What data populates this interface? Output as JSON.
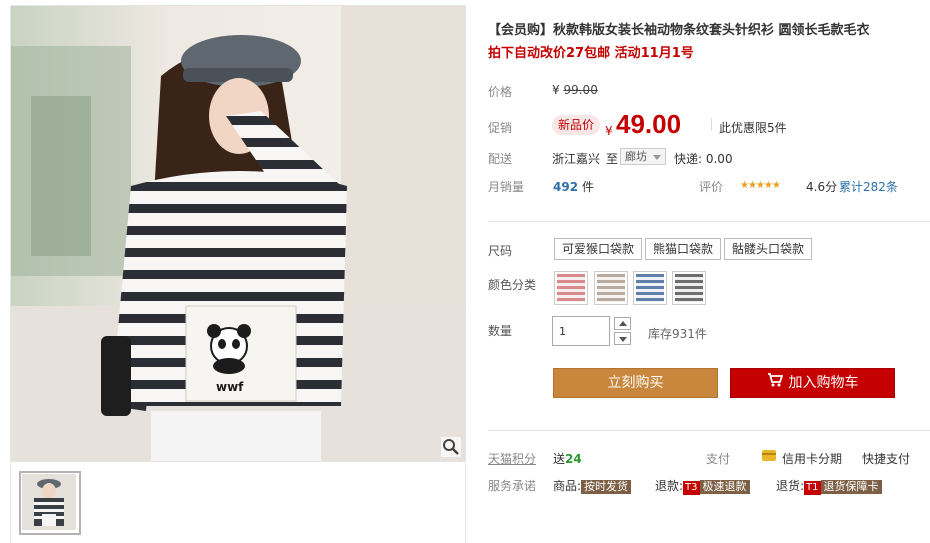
{
  "product": {
    "title": "【会员购】秋款韩版女装长袖动物条纹套头针织衫 圆领长毛款毛衣",
    "promo_line": "拍下自动改价27包邮 活动11月1号"
  },
  "price": {
    "label": "价格",
    "currency": "¥",
    "original": "99.00"
  },
  "promotion": {
    "label": "促销",
    "tag": "新品价",
    "currency": "¥",
    "value": "49.00",
    "limit_note": "此优惠限5件"
  },
  "delivery": {
    "label": "配送",
    "from": "浙江嘉兴",
    "to_word": "至",
    "destination": "廊坊",
    "shipping": "快递: 0.00"
  },
  "sales": {
    "label": "月销量",
    "count": "492",
    "unit": "件",
    "rating_label": "评价",
    "stars": "★★★★★",
    "score": "4.6分",
    "reviews": "累计282条"
  },
  "size": {
    "label": "尺码",
    "options": [
      "可爱猴口袋款",
      "熊猫口袋款",
      "骷髅头口袋款"
    ]
  },
  "color": {
    "label": "颜色分类",
    "swatches": [
      {
        "name": "pink-stripe",
        "a": "#d98a8a",
        "b": "#f4eeee"
      },
      {
        "name": "beige-stripe",
        "a": "#b9aaa0",
        "b": "#f6f3f0"
      },
      {
        "name": "blue-stripe",
        "a": "#5d7fa8",
        "b": "#eef2f6"
      },
      {
        "name": "grey-stripe",
        "a": "#6e6e6e",
        "b": "#efefef"
      }
    ]
  },
  "quantity": {
    "label": "数量",
    "value": "1",
    "stock": "库存931件"
  },
  "buttons": {
    "buy": "立刻购买",
    "cart": "加入购物车"
  },
  "points": {
    "label": "天猫积分",
    "prefix": "送",
    "value": "24",
    "pay_label": "支付",
    "installment": "信用卡分期",
    "quick_pay": "快捷支付"
  },
  "service": {
    "label": "服务承诺",
    "goods_label": "商品:",
    "goods_badge": "按时发货",
    "refund_label": "退款:",
    "refund_t": "T3",
    "refund_badge": "极速退款",
    "return_label": "退货:",
    "return_t": "T1",
    "return_badge": "退货保障卡"
  },
  "colors": {
    "accent_red": "#c40000",
    "buy_button": "#c9863d",
    "link_blue": "#2d6fa6"
  }
}
